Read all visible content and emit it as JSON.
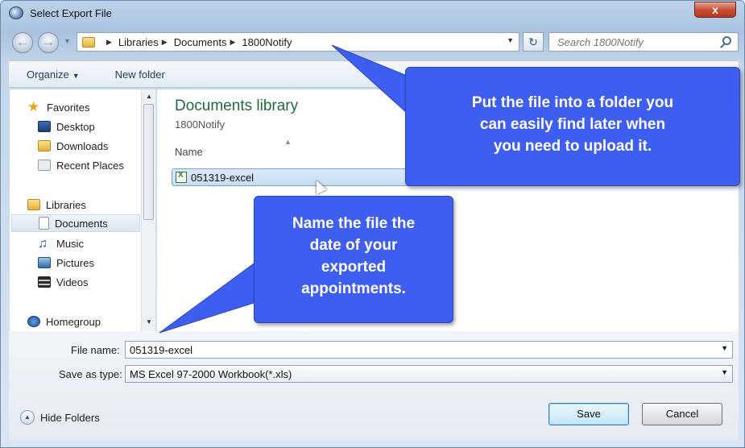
{
  "window": {
    "title": "Select Export File",
    "close_glyph": "x"
  },
  "address_bar": {
    "crumbs": [
      "Libraries",
      "Documents",
      "1800Notify"
    ],
    "search_placeholder": "Search 1800Notify"
  },
  "toolbar": {
    "organize_label": "Organize",
    "new_folder_label": "New folder"
  },
  "nav_pane": {
    "favorites": "Favorites",
    "desktop": "Desktop",
    "downloads": "Downloads",
    "recent_places": "Recent Places",
    "libraries": "Libraries",
    "documents": "Documents",
    "music": "Music",
    "pictures": "Pictures",
    "videos": "Videos",
    "homegroup": "Homegroup"
  },
  "main_pane": {
    "library_title": "Documents library",
    "library_subtitle": "1800Notify",
    "column_name": "Name",
    "files": [
      {
        "name": "051319-excel",
        "icon": "excel-icon",
        "selected": true
      }
    ]
  },
  "form": {
    "file_name_label": "File name:",
    "file_name_value": "051319-excel",
    "save_as_type_label": "Save as type:",
    "save_as_type_value": "MS Excel 97-2000 Workbook(*.xls)",
    "hide_folders_label": "Hide Folders",
    "save_label": "Save",
    "cancel_label": "Cancel"
  },
  "callouts": {
    "top": [
      "Put the file into a folder you",
      "can easily find later when",
      "you need to upload it."
    ],
    "middle": [
      "Name the file the",
      "date of your",
      "exported",
      "appointments."
    ],
    "color": "#3e5ef1"
  }
}
